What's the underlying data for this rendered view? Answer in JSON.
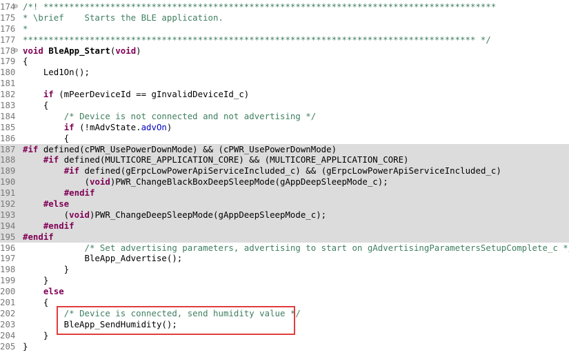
{
  "code_lines": [
    {
      "num": "174",
      "fold": "⊖",
      "pp": false,
      "segs": [
        {
          "t": "/*! ****************************************************************************************",
          "c": "cm"
        }
      ]
    },
    {
      "num": "175",
      "pp": false,
      "segs": [
        {
          "t": "* \\brief    Starts the BLE application.",
          "c": "cm"
        }
      ]
    },
    {
      "num": "176",
      "pp": false,
      "segs": [
        {
          "t": "*",
          "c": "cm"
        }
      ]
    },
    {
      "num": "177",
      "pp": false,
      "segs": [
        {
          "t": "**************************************************************************************** */",
          "c": "cm"
        }
      ]
    },
    {
      "num": "178",
      "fold": "⊖",
      "pp": false,
      "segs": [
        {
          "t": "void",
          "c": "kw"
        },
        {
          "t": " "
        },
        {
          "t": "BleApp_Start",
          "c": "fn"
        },
        {
          "t": "("
        },
        {
          "t": "void",
          "c": "kw"
        },
        {
          "t": ")"
        }
      ]
    },
    {
      "num": "179",
      "pp": false,
      "segs": [
        {
          "t": "{"
        }
      ]
    },
    {
      "num": "180",
      "pp": false,
      "segs": [
        {
          "t": "    Led1On();"
        }
      ]
    },
    {
      "num": "181",
      "pp": false,
      "segs": []
    },
    {
      "num": "182",
      "pp": false,
      "segs": [
        {
          "t": "    "
        },
        {
          "t": "if",
          "c": "kw"
        },
        {
          "t": " (mPeerDeviceId == gInvalidDeviceId_c)"
        }
      ]
    },
    {
      "num": "183",
      "pp": false,
      "segs": [
        {
          "t": "    {"
        }
      ]
    },
    {
      "num": "184",
      "pp": false,
      "segs": [
        {
          "t": "        "
        },
        {
          "t": "/* Device is not connected and not advertising */",
          "c": "cm"
        }
      ]
    },
    {
      "num": "185",
      "pp": false,
      "segs": [
        {
          "t": "        "
        },
        {
          "t": "if",
          "c": "kw"
        },
        {
          "t": " (!mAdvState."
        },
        {
          "t": "advOn",
          "c": "fld"
        },
        {
          "t": ")"
        }
      ]
    },
    {
      "num": "186",
      "pp": false,
      "segs": [
        {
          "t": "        {"
        }
      ]
    },
    {
      "num": "187",
      "pp": true,
      "segs": [
        {
          "t": "#if",
          "c": "kw"
        },
        {
          "t": " defined(cPWR_UsePowerDownMode) && (cPWR_UsePowerDownMode)"
        }
      ]
    },
    {
      "num": "188",
      "pp": true,
      "segs": [
        {
          "t": "    "
        },
        {
          "t": "#if",
          "c": "kw"
        },
        {
          "t": " defined(MULTICORE_APPLICATION_CORE) && (MULTICORE_APPLICATION_CORE)"
        }
      ]
    },
    {
      "num": "189",
      "pp": true,
      "segs": [
        {
          "t": "        "
        },
        {
          "t": "#if",
          "c": "kw"
        },
        {
          "t": " defined(gErpcLowPowerApiServiceIncluded_c) && (gErpcLowPowerApiServiceIncluded_c)"
        }
      ]
    },
    {
      "num": "190",
      "pp": true,
      "segs": [
        {
          "t": "            ("
        },
        {
          "t": "void",
          "c": "kw"
        },
        {
          "t": ")PWR_ChangeBlackBoxDeepSleepMode(gAppDeepSleepMode_c);"
        }
      ]
    },
    {
      "num": "191",
      "pp": true,
      "segs": [
        {
          "t": "        "
        },
        {
          "t": "#endif",
          "c": "kw"
        }
      ]
    },
    {
      "num": "192",
      "pp": true,
      "segs": [
        {
          "t": "    "
        },
        {
          "t": "#else",
          "c": "kw"
        }
      ]
    },
    {
      "num": "193",
      "pp": true,
      "segs": [
        {
          "t": "        ("
        },
        {
          "t": "void",
          "c": "kw"
        },
        {
          "t": ")PWR_ChangeDeepSleepMode(gAppDeepSleepMode_c);"
        }
      ]
    },
    {
      "num": "194",
      "pp": true,
      "segs": [
        {
          "t": "    "
        },
        {
          "t": "#endif",
          "c": "kw"
        }
      ]
    },
    {
      "num": "195",
      "pp": true,
      "segs": [
        {
          "t": "#endif",
          "c": "kw"
        }
      ]
    },
    {
      "num": "196",
      "pp": false,
      "segs": [
        {
          "t": "            "
        },
        {
          "t": "/* Set advertising parameters, advertising to start on gAdvertisingParametersSetupComplete_c */",
          "c": "cm"
        }
      ]
    },
    {
      "num": "197",
      "pp": false,
      "segs": [
        {
          "t": "            BleApp_Advertise();"
        }
      ]
    },
    {
      "num": "198",
      "pp": false,
      "segs": [
        {
          "t": "        }"
        }
      ]
    },
    {
      "num": "199",
      "pp": false,
      "segs": [
        {
          "t": "    }"
        }
      ]
    },
    {
      "num": "200",
      "pp": false,
      "segs": [
        {
          "t": "    "
        },
        {
          "t": "else",
          "c": "kw"
        }
      ]
    },
    {
      "num": "201",
      "pp": false,
      "segs": [
        {
          "t": "    {"
        }
      ]
    },
    {
      "num": "202",
      "pp": false,
      "segs": [
        {
          "t": "        "
        },
        {
          "t": "/* Device is connected, send humidity value */",
          "c": "cm"
        }
      ]
    },
    {
      "num": "203",
      "pp": false,
      "segs": [
        {
          "t": "        BleApp_SendHumidity();"
        }
      ]
    },
    {
      "num": "204",
      "pp": false,
      "segs": [
        {
          "t": "    }"
        }
      ]
    },
    {
      "num": "205",
      "pp": false,
      "segs": [
        {
          "t": "}"
        }
      ]
    }
  ],
  "colors": {
    "keyword": "#7f0055",
    "comment": "#3f7f5f",
    "field": "#0000c0",
    "preprocessor_background": "#dcdcdc",
    "highlight_border": "#e03c3c"
  }
}
